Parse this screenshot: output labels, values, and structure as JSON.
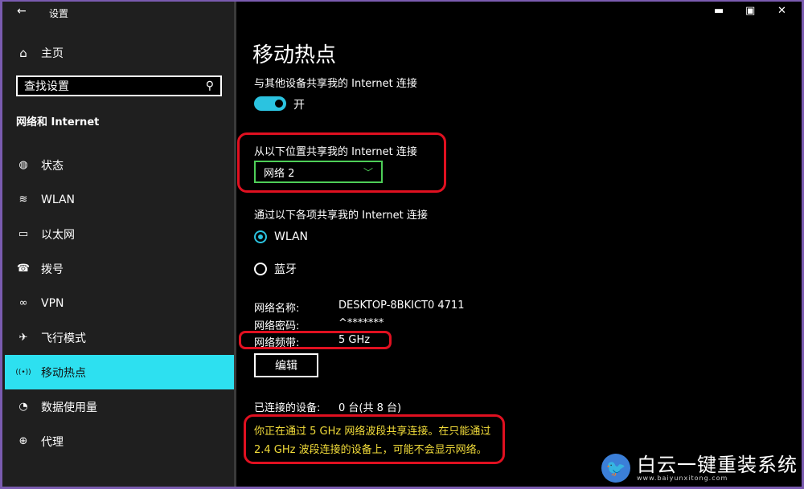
{
  "window": {
    "title": "设置",
    "back_icon": "←",
    "controls": {
      "minimize": "▬",
      "maximize": "▣",
      "close": "✕"
    }
  },
  "sidebar": {
    "home_label": "主页",
    "home_icon": "⌂",
    "search_placeholder": "查找设置",
    "search_icon": "⚲",
    "section_title": "网络和 Internet",
    "items": [
      {
        "label": "状态",
        "icon": "◍"
      },
      {
        "label": "WLAN",
        "icon": "≋"
      },
      {
        "label": "以太网",
        "icon": "▭"
      },
      {
        "label": "拨号",
        "icon": "☎"
      },
      {
        "label": "VPN",
        "icon": "∞"
      },
      {
        "label": "飞行模式",
        "icon": "✈"
      },
      {
        "label": "移动热点",
        "icon": "((•))"
      },
      {
        "label": "数据使用量",
        "icon": "◔"
      },
      {
        "label": "代理",
        "icon": "⊕"
      }
    ],
    "active_index": 6
  },
  "main": {
    "title": "移动热点",
    "share_label": "与其他设备共享我的 Internet 连接",
    "toggle_state": "开",
    "toggle_on": true,
    "source_label": "从以下位置共享我的 Internet 连接",
    "source_value": "网络 2",
    "via_label": "通过以下各项共享我的 Internet 连接",
    "radio_options": [
      {
        "label": "WLAN",
        "selected": true
      },
      {
        "label": "蓝牙",
        "selected": false
      }
    ],
    "network_name_label": "网络名称:",
    "network_name_value": "DESKTOP-8BKICT0 4711",
    "network_password_label": "网络密码:",
    "network_password_value": "^*******",
    "network_band_label": "网络频带:",
    "network_band_value": "5 GHz",
    "edit_button": "编辑",
    "connected_label": "已连接的设备:",
    "connected_value": "0 台(共 8 台)",
    "notice_line1": "你正在通过 5 GHz 网络波段共享连接。在只能通过",
    "notice_line2": "2.4 GHz 波段连接的设备上，可能不会显示网络。"
  },
  "brand": {
    "name": "白云一键重装系统",
    "url": "www.baiyunxitong.com"
  },
  "colors": {
    "accent": "#2de0f0",
    "highlight": "#e01020",
    "dropdown_border": "#4ecf58",
    "notice": "#f2dc3a"
  }
}
